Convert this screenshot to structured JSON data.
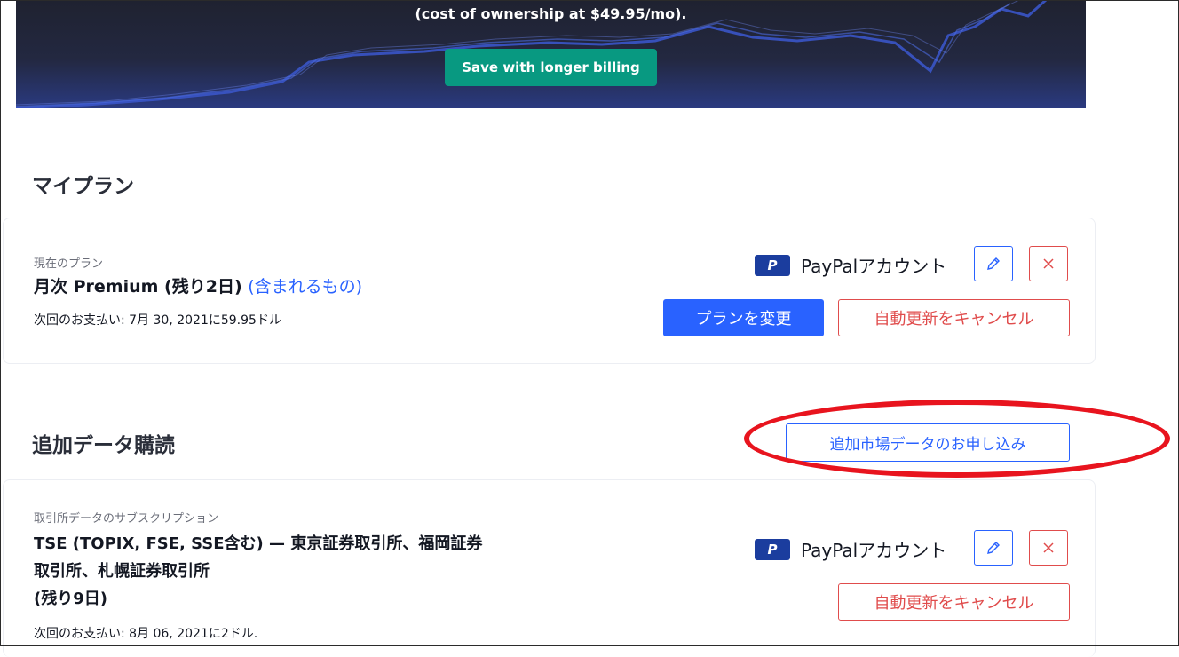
{
  "banner": {
    "text": "(cost of ownership at $49.95/mo).",
    "button_label": "Save with longer billing"
  },
  "my_plan": {
    "title": "マイプラン",
    "current_label": "現在のプラン",
    "plan_name": "月次 Premium (残り2日)",
    "plan_link": "(含まれるもの)",
    "next_payment": "次回のお支払い: 7月 30, 2021に59.95ドル",
    "payment_method": "PayPalアカウント",
    "paypal_logo": "P",
    "change_plan_label": "プランを変更",
    "cancel_renewal_label": "自動更新をキャンセル"
  },
  "additional_data": {
    "title": "追加データ購読",
    "add_market_label": "追加市場データのお申し込み",
    "item": {
      "label": "取引所データのサブスクリプション",
      "name_line1": "TSE (TOPIX, FSE, SSE含む) — 東京証券取引所、福岡証券",
      "name_line2": "取引所、札幌証券取引所",
      "name_line3": "(残り9日)",
      "next_payment": "次回のお支払い: 8月 06, 2021に2ドル.",
      "payment_method": "PayPalアカウント",
      "paypal_logo": "P",
      "cancel_renewal_label": "自動更新をキャンセル"
    }
  },
  "colors": {
    "accent_blue": "#2962ff",
    "danger_red": "#e04c4c",
    "teal": "#089981",
    "annotation_red": "#e8141e"
  },
  "icons": [
    "pencil-icon",
    "close-icon",
    "paypal-icon"
  ]
}
